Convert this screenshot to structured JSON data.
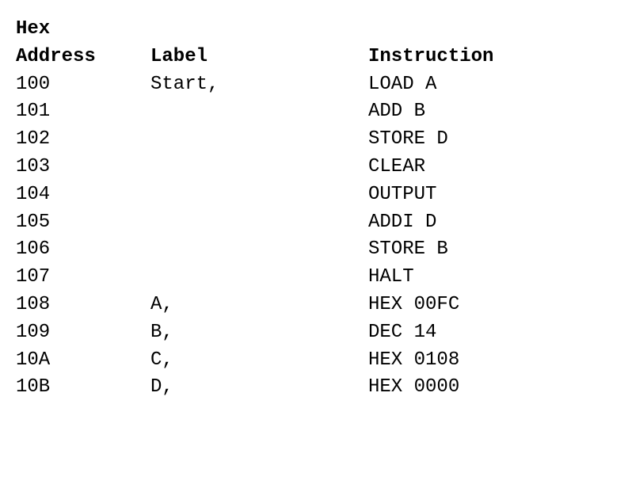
{
  "headers": {
    "address_line1": "Hex",
    "address_line2": "Address",
    "label": "Label",
    "instruction": "Instruction"
  },
  "rows": [
    {
      "address": "100",
      "label": "Start,",
      "instruction": "LOAD A"
    },
    {
      "address": "101",
      "label": "",
      "instruction": "ADD B"
    },
    {
      "address": "102",
      "label": "",
      "instruction": "STORE D"
    },
    {
      "address": "103",
      "label": "",
      "instruction": "CLEAR"
    },
    {
      "address": "104",
      "label": "",
      "instruction": "OUTPUT"
    },
    {
      "address": "105",
      "label": "",
      "instruction": "ADDI D"
    },
    {
      "address": "106",
      "label": "",
      "instruction": "STORE B"
    },
    {
      "address": "107",
      "label": "",
      "instruction": "HALT"
    },
    {
      "address": "108",
      "label": "A,",
      "instruction": "HEX 00FC"
    },
    {
      "address": "109",
      "label": "B,",
      "instruction": "DEC 14"
    },
    {
      "address": "10A",
      "label": "C,",
      "instruction": "HEX 0108"
    },
    {
      "address": "10B",
      "label": "D,",
      "instruction": "HEX 0000"
    }
  ]
}
